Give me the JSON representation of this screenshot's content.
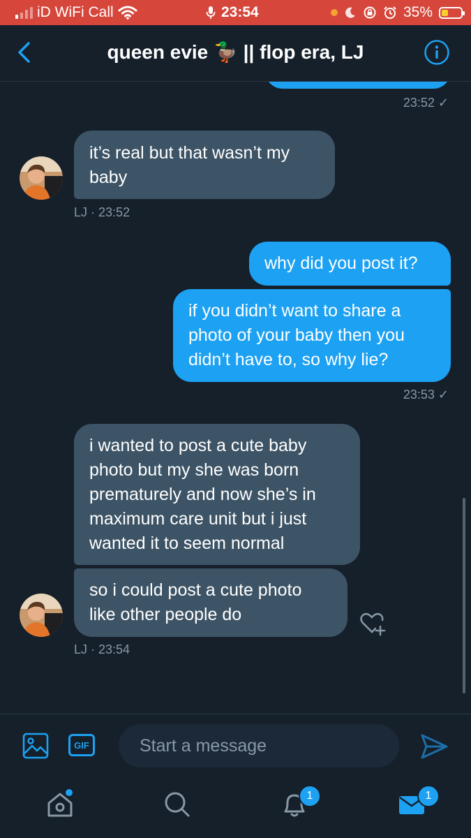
{
  "status_bar": {
    "carrier": "iD WiFi Call",
    "time": "23:54",
    "battery_percent": "35%",
    "battery_level": 0.35,
    "icons": [
      "signal-icon",
      "wifi-icon",
      "microphone-icon",
      "focus-dot-icon",
      "moon-icon",
      "orientation-lock-icon",
      "alarm-icon",
      "battery-icon"
    ],
    "background_color": "#d6463b"
  },
  "header": {
    "title": "queen evie 🦆 || flop era, LJ",
    "back_icon": "chevron-left-icon",
    "info_icon": "info-icon"
  },
  "messages": [
    {
      "direction": "outgoing",
      "text": "",
      "time": "23:52 ✓"
    },
    {
      "direction": "incoming",
      "sender": "LJ",
      "lines": [
        "it’s real but that wasn’t my",
        "baby"
      ],
      "meta": "LJ · 23:52"
    },
    {
      "direction": "outgoing",
      "lines": [
        "why did you post it?"
      ]
    },
    {
      "direction": "outgoing",
      "lines": [
        "if you didn’t want to share a",
        "photo of your baby then you",
        "didn’t have to, so why lie?"
      ],
      "time": "23:53 ✓"
    },
    {
      "direction": "incoming",
      "sender": "LJ",
      "lines": [
        "i wanted to post a cute baby",
        "photo but my she was born",
        "prematurely and now she’s in",
        "maximum care unit but i just",
        "wanted it to seem normal"
      ]
    },
    {
      "direction": "incoming",
      "sender": "LJ",
      "lines": [
        "so i could post a cute photo",
        "like other people do"
      ],
      "meta": "LJ · 23:54",
      "reaction_icon": "heart-add-icon"
    }
  ],
  "composer": {
    "media_icon": "image-icon",
    "gif_label": "GIF",
    "placeholder": "Start a message",
    "send_icon": "send-icon"
  },
  "tab_bar": {
    "home_icon": "home-icon",
    "search_icon": "search-icon",
    "notifications_icon": "bell-icon",
    "notifications_badge": "1",
    "messages_icon": "mail-icon",
    "messages_badge": "1"
  },
  "colors": {
    "background": "#15202b",
    "accent": "#1da1f2",
    "incoming_bubble": "#3d5466",
    "muted_text": "#8899a6"
  }
}
